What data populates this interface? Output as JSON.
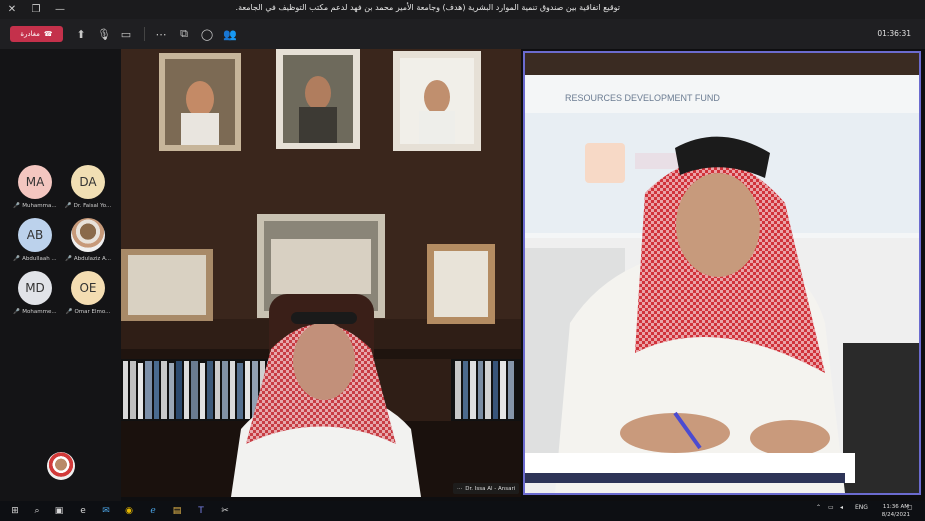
{
  "window": {
    "title": "توقيع اتفاقية بين صندوق تنمية الموارد البشرية (هدف) وجامعة الأمير محمد بن فهد لدعم مكتب التوظيف في الجامعة.",
    "controls": [
      "close-icon",
      "restore-icon",
      "minimize-icon"
    ]
  },
  "toolbar": {
    "leave_label": "مغادرة",
    "timer": "01:36:31",
    "buttons": [
      "share-icon",
      "mic-off-icon",
      "camera-off-icon",
      "more-icon",
      "breakout-icon",
      "chat-icon",
      "participants-icon"
    ]
  },
  "roster": {
    "participants": [
      {
        "initials": "MA",
        "name": "Muhamma...",
        "color": "#f3c6c0"
      },
      {
        "initials": "DA",
        "name": "Dr. Faisal Yo...",
        "color": "#f1dfb4"
      },
      {
        "initials": "AB",
        "name": "Abdullaah ...",
        "color": "#bcd2ec"
      },
      {
        "initials": "",
        "name": "Abdulaziz A...",
        "color": "#d9d9d9",
        "photo": true
      },
      {
        "initials": "MD",
        "name": "Mohamme...",
        "color": "#e1e3e8"
      },
      {
        "initials": "OE",
        "name": "Omar Elmo...",
        "color": "#f4ddb2"
      }
    ]
  },
  "videos": {
    "left_name": "Dr. Issa Al - Ansari",
    "right_banner": "RESOURCES DEVELOPMENT FUND"
  },
  "taskbar": {
    "language": "ENG",
    "time": "11:36 AM",
    "date": "8/24/2021"
  }
}
